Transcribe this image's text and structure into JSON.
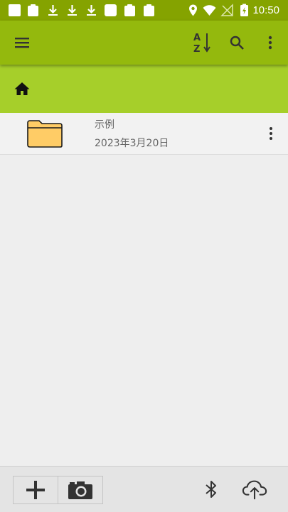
{
  "status_bar": {
    "time": "10:50",
    "left_icons": [
      "notification-icon",
      "clipboard-icon",
      "download-icon",
      "download-icon",
      "download-icon",
      "notification-icon",
      "clipboard-icon",
      "clipboard-icon"
    ],
    "right_icons": [
      "location-icon",
      "wifi-icon",
      "no-sim-icon",
      "battery-charging-icon"
    ]
  },
  "toolbar": {
    "menu_icon": "hamburger-menu-icon",
    "sort_icon": "sort-az-icon",
    "sort_letters": [
      "A",
      "Z"
    ],
    "search_icon": "search-icon",
    "overflow_icon": "more-vertical-icon"
  },
  "breadcrumb": {
    "home_icon": "home-icon"
  },
  "files": [
    {
      "name": "示例",
      "date": "2023年3月20日",
      "type": "folder"
    }
  ],
  "bottom_bar": {
    "add_icon": "plus-icon",
    "camera_icon": "camera-icon",
    "bluetooth_icon": "bluetooth-icon",
    "upload_icon": "cloud-upload-icon"
  },
  "colors": {
    "status_bar": "#85a300",
    "toolbar": "#94b90d",
    "breadcrumb": "#a6cf2a",
    "folder_fill": "#ffcc66",
    "background": "#eeeeee"
  }
}
